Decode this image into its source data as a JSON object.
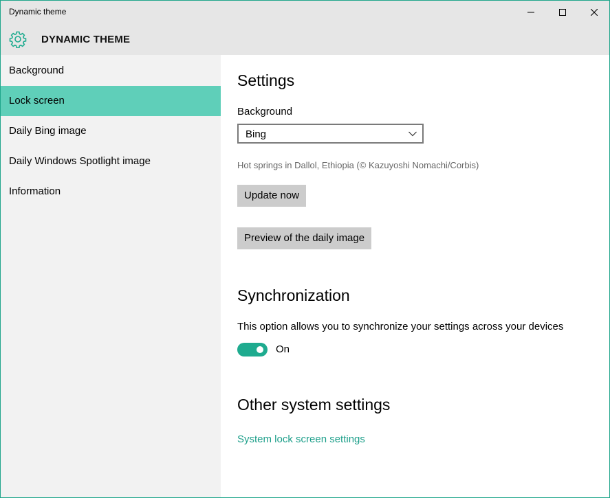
{
  "window": {
    "title": "Dynamic theme"
  },
  "header": {
    "app_title": "DYNAMIC THEME",
    "icon": "gear-icon",
    "accent": "#1eab8f"
  },
  "sidebar": {
    "items": [
      {
        "label": "Background",
        "selected": false
      },
      {
        "label": "Lock screen",
        "selected": true
      },
      {
        "label": "Daily Bing image",
        "selected": false
      },
      {
        "label": "Daily Windows Spotlight image",
        "selected": false
      },
      {
        "label": "Information",
        "selected": false
      }
    ],
    "selected_color": "#5fcfb9"
  },
  "settings": {
    "heading": "Settings",
    "background_label": "Background",
    "background_value": "Bing",
    "image_caption": "Hot springs in Dallol, Ethiopia (© Kazuyoshi Nomachi/Corbis)",
    "update_button": "Update now",
    "preview_button": "Preview of the daily image"
  },
  "sync": {
    "heading": "Synchronization",
    "description": "This option allows you to synchronize your settings across your devices",
    "toggle_state": "On",
    "toggle_on": true
  },
  "other": {
    "heading": "Other system settings",
    "link": "System lock screen settings"
  }
}
